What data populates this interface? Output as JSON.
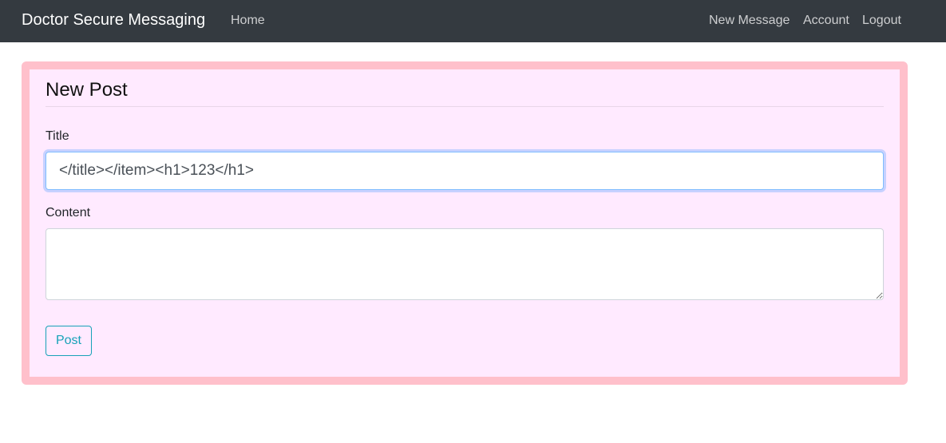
{
  "navbar": {
    "brand": "Doctor Secure Messaging",
    "left_links": [
      {
        "label": "Home"
      }
    ],
    "right_links": [
      {
        "label": "New Message"
      },
      {
        "label": "Account"
      },
      {
        "label": "Logout"
      }
    ],
    "background_color": "#343a40"
  },
  "form": {
    "legend": "New Post",
    "title_label": "Title",
    "title_value": "</title></item><h1>123</h1>",
    "content_label": "Content",
    "content_value": "",
    "submit_label": "Post"
  },
  "colors": {
    "panel_border": "#ffc0cb",
    "panel_background": "#ffeaff",
    "button_accent": "#17a2b8"
  }
}
